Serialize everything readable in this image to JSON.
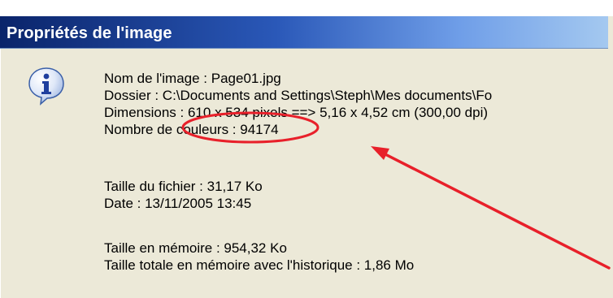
{
  "dialog": {
    "title": "Propriétés de l'image",
    "icon": "info-icon",
    "file_info": {
      "name_line": "Nom de l'image : Page01.jpg",
      "folder_line": "Dossier : C:\\Documents and Settings\\Steph\\Mes documents\\Fo",
      "dimensions_line": "Dimensions : 610 x 534 pixels ==> 5,16 x 4,52 cm  (300,00 dpi)",
      "colors_line": "Nombre de couleurs : 94174"
    },
    "file_details": {
      "size_line": "Taille du fichier : 31,17 Ko",
      "date_line": "Date : 13/11/2005 13:45"
    },
    "memory": {
      "memory_line": "Taille en mémoire : 954,32 Ko",
      "total_memory_line": "Taille totale en mémoire avec l'historique : 1,86 Mo"
    }
  },
  "annotation": {
    "color": "#e8202a",
    "shape": "ellipse-with-arrow"
  },
  "colors": {
    "title_dark": "#0a246a",
    "title_light": "#a6caf0",
    "dialog_bg": "#ece9d8"
  }
}
